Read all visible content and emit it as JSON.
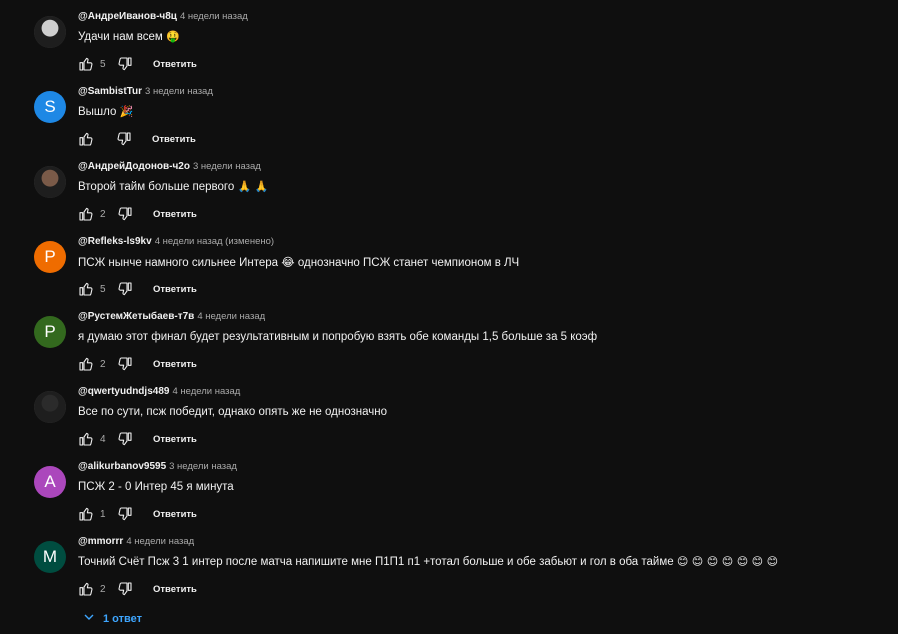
{
  "comments": [
    {
      "author": "@АндреИванов-ч8ц",
      "time": "4 недели назад",
      "text": "Удачи нам всем",
      "emoji": "🤑",
      "likes": "5",
      "reply_label": "Ответить",
      "avatar": {
        "type": "photo",
        "color": "#cfcfcf"
      }
    },
    {
      "author": "@SambistTur",
      "time": "3 недели назад",
      "text": "Вышло",
      "emoji": "🎉",
      "likes": "",
      "reply_label": "Ответить",
      "avatar": {
        "type": "letter",
        "letter": "S",
        "color": "#1e88e5"
      }
    },
    {
      "author": "@АндрейДодонов-ч2о",
      "time": "3 недели назад",
      "text": "Второй тайм больше первого",
      "emoji": "🙏 🙏",
      "likes": "2",
      "reply_label": "Ответить",
      "avatar": {
        "type": "photo",
        "color": "#7a5a48"
      }
    },
    {
      "author": "@Refleks-ls9kv",
      "time": "4 недели назад (изменено)",
      "text": "ПСЖ нынче намного сильнее Интера 😂 однозначно ПСЖ станет чемпионом в ЛЧ",
      "emoji": "",
      "likes": "5",
      "reply_label": "Ответить",
      "avatar": {
        "type": "letter",
        "letter": "P",
        "color": "#ef6c00"
      }
    },
    {
      "author": "@РустемЖетыбаев-т7в",
      "time": "4 недели назад",
      "text": "я думаю этот финал будет результативным и попробую взять обе команды 1,5 больше за 5 коэф",
      "emoji": "",
      "likes": "2",
      "reply_label": "Ответить",
      "avatar": {
        "type": "letter",
        "letter": "Р",
        "color": "#33691e"
      }
    },
    {
      "author": "@qwertyudndjs489",
      "time": "4 недели назад",
      "text": "Все по сути, псж победит, однако опять же не однозначно",
      "emoji": "",
      "likes": "4",
      "reply_label": "Ответить",
      "avatar": {
        "type": "photo",
        "color": "#2b2b2b"
      }
    },
    {
      "author": "@alikurbanov9595",
      "time": "3 недели назад",
      "text": "ПСЖ 2 - 0 Интер   45 я минута",
      "emoji": "",
      "likes": "1",
      "reply_label": "Ответить",
      "avatar": {
        "type": "letter",
        "letter": "A",
        "color": "#ab47bc"
      }
    },
    {
      "author": "@mmorrr",
      "time": "4 недели назад",
      "text": "Точний Счёт Псж 3  1 интер после матча напишите мне  П1П1  п1 +тотал больше и обе забьют и гол в оба тайме",
      "emoji": "😊 😊 😊 😊 😊 😊 😊",
      "likes": "2",
      "reply_label": "Ответить",
      "avatar": {
        "type": "letter",
        "letter": "M",
        "color": "#004d40"
      }
    }
  ],
  "replies_toggle": {
    "label": "1 ответ",
    "color": "#3ea6ff"
  },
  "icons": {
    "like": "thumb-up-icon",
    "dislike": "thumb-down-icon",
    "expand": "chevron-down-icon"
  }
}
